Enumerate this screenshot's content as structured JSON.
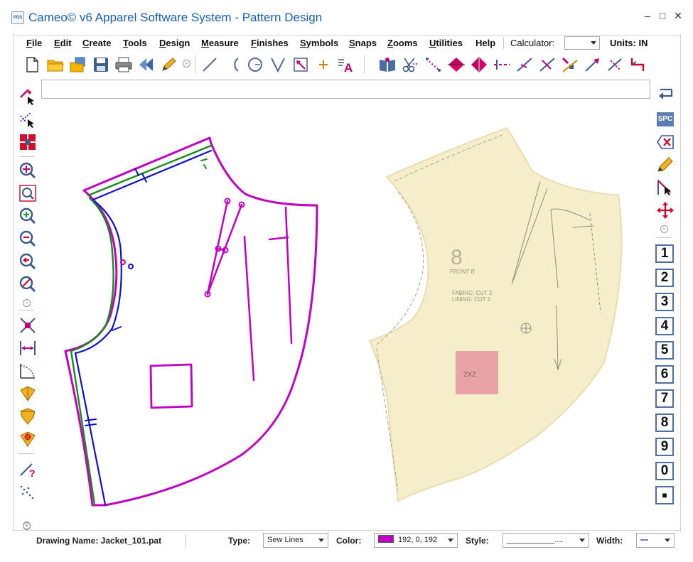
{
  "window": {
    "title": "Cameo© v6 Apparel Software System - Pattern Design",
    "app_icon_label": "PDS",
    "minimize": "–",
    "maximize": "□",
    "close": "✕"
  },
  "menu": {
    "items": [
      {
        "u": "F",
        "rest": "ile"
      },
      {
        "u": "E",
        "rest": "dit"
      },
      {
        "u": "C",
        "rest": "reate"
      },
      {
        "u": "T",
        "rest": "ools"
      },
      {
        "u": "D",
        "rest": "esign"
      },
      {
        "u": "M",
        "rest": "easure"
      },
      {
        "u": "F",
        "rest": "inishes"
      },
      {
        "u": "S",
        "rest": "ymbols"
      },
      {
        "u": "S",
        "rest": "naps"
      },
      {
        "u": "Z",
        "rest": "ooms"
      },
      {
        "u": "U",
        "rest": "tilities"
      },
      {
        "u": "",
        "rest": "Help"
      }
    ],
    "calculator_label": "Calculator:",
    "calculator_value": "",
    "units_label": "Units: IN"
  },
  "toolbar": {
    "buttons": [
      "new-file-icon",
      "open-folder-icon",
      "open-multiple-icon",
      "save-icon",
      "print-icon",
      "back-icon",
      "pencil-edit-icon",
      "line-tool-icon",
      "arc-tool-icon",
      "circle-tool-icon",
      "dart-tool-icon",
      "rectangle-arrow-icon",
      "point-plus-icon",
      "text-tool-icon",
      "book-icon",
      "scissors-icon",
      "dotted-trace-icon",
      "flip-vertical-icon",
      "flip-horizontal-icon",
      "notch-line-icon",
      "measure-line-icon",
      "cross-measure-icon",
      "grade-icon",
      "angle-arrow-icon",
      "add-point-icon",
      "red-connector-icon"
    ],
    "overflow": "»"
  },
  "left_tools": [
    "select-delete-icon",
    "select-dotted-icon",
    "grid-point-icon",
    "zoom-in-icon",
    "zoom-window-icon",
    "zoom-plus-icon",
    "zoom-minus-icon",
    "zoom-previous-icon",
    "zoom-cancel-icon",
    "cross-swap-icon",
    "width-measure-icon",
    "curve-measure-icon",
    "yellow-pin-icon",
    "yellow-drop-icon",
    "yellow-target-icon",
    "question-line-icon",
    "dots-line-icon"
  ],
  "right_tools": {
    "icons": [
      "enter-return-icon",
      "space-key-icon",
      "delete-key-icon",
      "pencil-icon",
      "pointer-line-icon",
      "move-cross-icon"
    ],
    "spc_label": "SPC",
    "keys": [
      "1",
      "2",
      "3",
      "4",
      "5",
      "6",
      "7",
      "8",
      "9",
      "0",
      "■"
    ]
  },
  "command_line": {
    "value": ""
  },
  "canvas": {
    "photo_label_main": "8",
    "photo_label_front": "FRONT B",
    "photo_fabric": "FABRIC: CUT 2",
    "photo_lining": "LINING: CUT 2",
    "photo_square_label": "2X2"
  },
  "status": {
    "drawing_name_label": "Drawing Name: Jacket_101.pat",
    "type_label": "Type:",
    "type_value": "Sew Lines",
    "color_label": "Color:",
    "color_value": "192, 0, 192",
    "color_hex": "#c000c0",
    "style_label": "Style:",
    "style_value": "___________....",
    "width_label": "Width:",
    "width_value": "—"
  }
}
